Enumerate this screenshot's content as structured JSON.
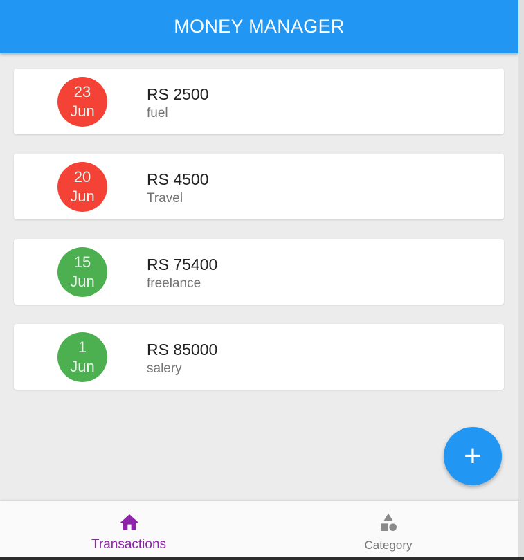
{
  "app_bar": {
    "title": "MONEY MANAGER"
  },
  "transactions": [
    {
      "day": "23",
      "month": "Jun",
      "amount": "RS 2500",
      "category": "fuel",
      "type": "expense",
      "color": "#f44336"
    },
    {
      "day": "20",
      "month": "Jun",
      "amount": "RS 4500",
      "category": "Travel",
      "type": "expense",
      "color": "#f44336"
    },
    {
      "day": "15",
      "month": "Jun",
      "amount": "RS 75400",
      "category": "freelance",
      "type": "income",
      "color": "#4caf50"
    },
    {
      "day": "1",
      "month": "Jun",
      "amount": "RS 85000",
      "category": "salery",
      "type": "income",
      "color": "#4caf50"
    }
  ],
  "fab": {
    "icon": "add-icon",
    "label": "+"
  },
  "bottom_nav": {
    "items": [
      {
        "label": "Transactions",
        "icon": "home-icon",
        "active": true,
        "color": "#8e24aa"
      },
      {
        "label": "Category",
        "icon": "shapes-icon",
        "active": false,
        "color": "#777777"
      }
    ]
  },
  "colors": {
    "primary": "#2196f3",
    "expense": "#f44336",
    "income": "#4caf50",
    "background": "#ececec"
  }
}
